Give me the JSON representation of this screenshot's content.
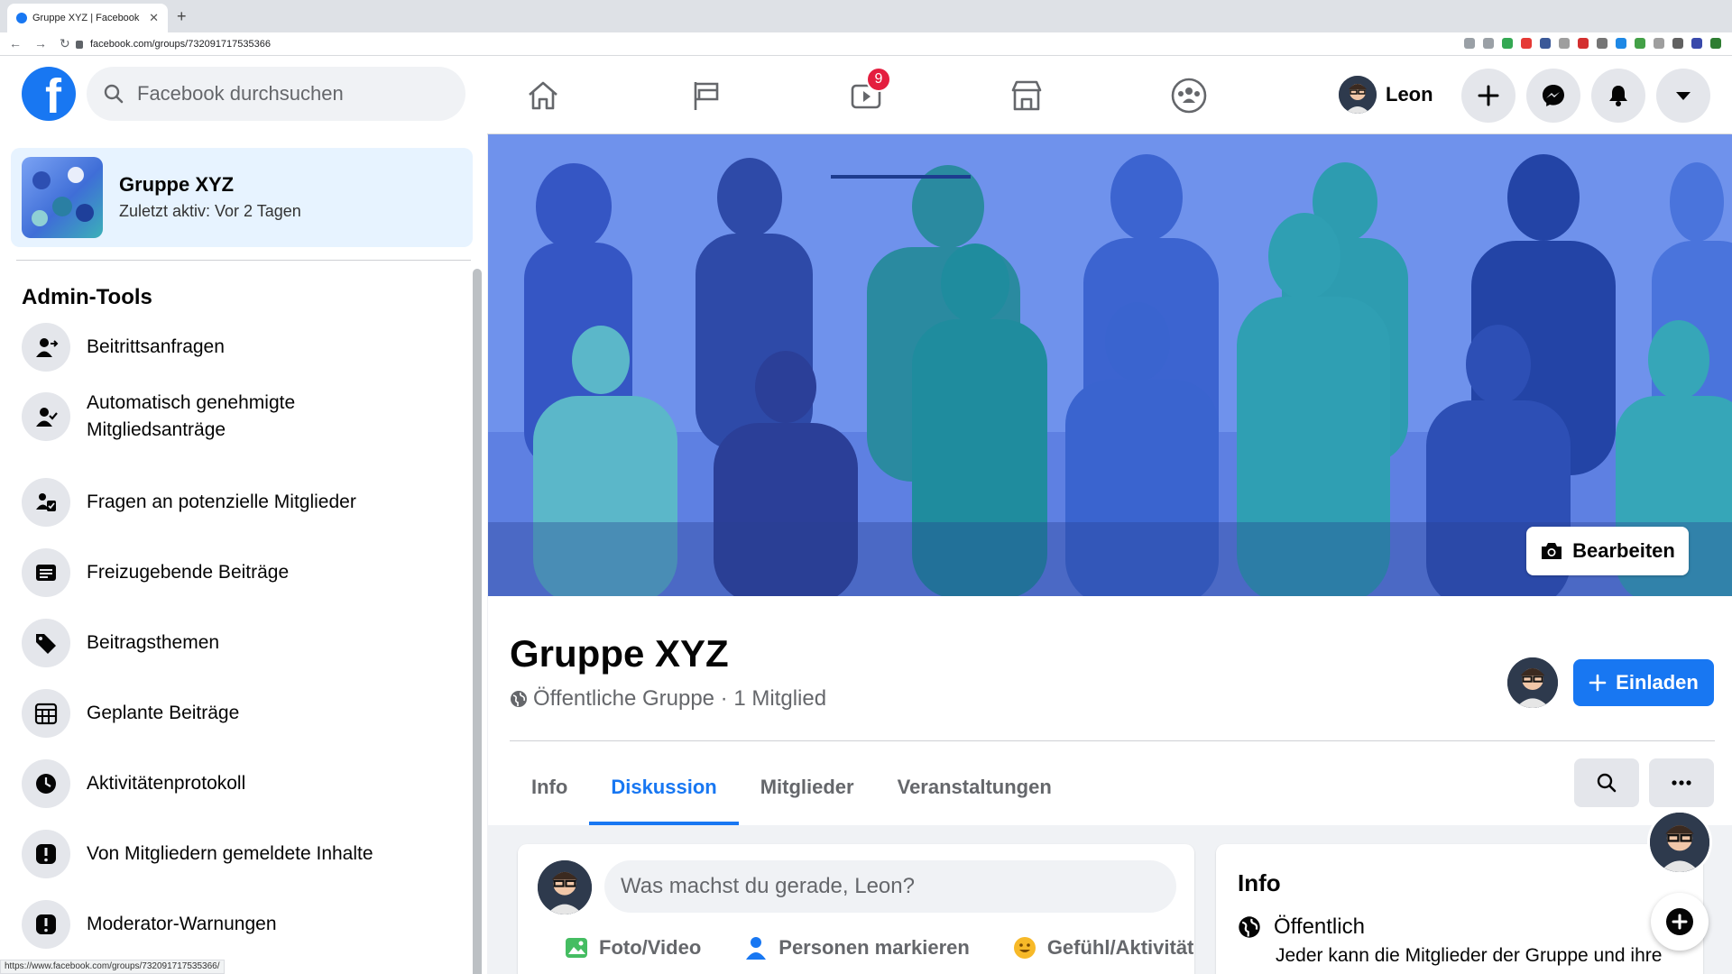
{
  "browser": {
    "tab_title": "Gruppe XYZ | Facebook",
    "url": "facebook.com/groups/732091717535366",
    "status_url": "https://www.facebook.com/groups/732091717535366/"
  },
  "header": {
    "search_placeholder": "Facebook durchsuchen",
    "watch_badge": "9",
    "user_name": "Leon"
  },
  "sidebar": {
    "group_name": "Gruppe XYZ",
    "group_activity": "Zuletzt aktiv: Vor 2 Tagen",
    "section_title": "Admin-Tools",
    "items": [
      {
        "label": "Beitrittsanfragen",
        "icon": "person-arrow-icon"
      },
      {
        "label": "Automatisch genehmigte Mitgliedsanträge",
        "icon": "person-check-icon"
      },
      {
        "label": "Fragen an potenzielle Mitglieder",
        "icon": "person-clipboard-icon"
      },
      {
        "label": "Freizugebende Beiträge",
        "icon": "post-icon"
      },
      {
        "label": "Beitragsthemen",
        "icon": "tag-icon"
      },
      {
        "label": "Geplante Beiträge",
        "icon": "calendar-icon"
      },
      {
        "label": "Aktivitätenprotokoll",
        "icon": "clock-icon"
      },
      {
        "label": "Von Mitgliedern gemeldete Inhalte",
        "icon": "alert-icon"
      },
      {
        "label": "Moderator-Warnungen",
        "icon": "alert-icon"
      }
    ]
  },
  "main": {
    "edit_cover_label": "Bearbeiten",
    "group_title": "Gruppe XYZ",
    "group_meta": "Öffentliche Gruppe · 1 Mitglied",
    "invite_label": "Einladen",
    "tabs": [
      {
        "label": "Info",
        "active": false
      },
      {
        "label": "Diskussion",
        "active": true
      },
      {
        "label": "Mitglieder",
        "active": false
      },
      {
        "label": "Veranstaltungen",
        "active": false
      }
    ],
    "composer": {
      "placeholder": "Was machst du gerade, Leon?",
      "actions": [
        "Foto/Video",
        "Personen markieren",
        "Gefühl/Aktivität"
      ]
    },
    "info_card": {
      "title": "Info",
      "privacy": "Öffentlich",
      "description": "Jeder kann die Mitglieder der Gruppe und ihre"
    }
  },
  "colors": {
    "brand": "#1877f2",
    "badge": "#e41e3f",
    "cover": "#5f84e8"
  }
}
